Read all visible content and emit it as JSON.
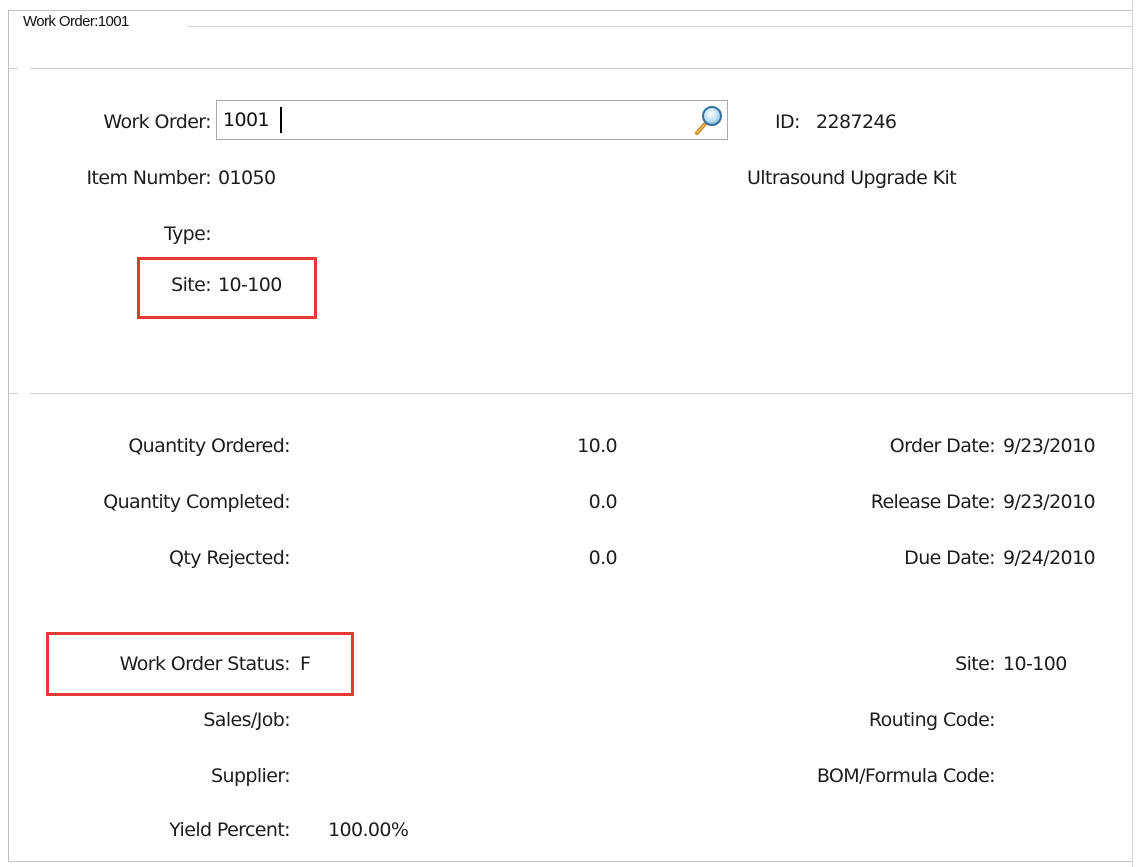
{
  "window": {
    "title": "Work Order:1001"
  },
  "header": {
    "work_order_label": "Work Order:",
    "work_order_value": "1001",
    "id_label": "ID:",
    "id_value": "2287246",
    "item_number_label": "Item Number:",
    "item_number_value": "01050",
    "item_description": "Ultrasound Upgrade Kit",
    "type_label": "Type:",
    "type_value": "",
    "site_label": "Site:",
    "site_value": "10-100"
  },
  "quantities": {
    "ordered_label": "Quantity Ordered:",
    "ordered_value": "10.0",
    "completed_label": "Quantity Completed:",
    "completed_value": "0.0",
    "rejected_label": "Qty Rejected:",
    "rejected_value": "0.0"
  },
  "dates": {
    "order_date_label": "Order Date:",
    "order_date_value": "9/23/2010",
    "release_date_label": "Release Date:",
    "release_date_value": "9/23/2010",
    "due_date_label": "Due Date:",
    "due_date_value": "9/24/2010"
  },
  "status": {
    "status_label": "Work Order Status:",
    "status_value": "F",
    "site_label": "Site:",
    "site_value": "10-100",
    "sales_job_label": "Sales/Job:",
    "sales_job_value": "",
    "routing_code_label": "Routing Code:",
    "routing_code_value": "",
    "supplier_label": "Supplier:",
    "supplier_value": "",
    "bom_formula_label": "BOM/Formula Code:",
    "bom_formula_value": "",
    "yield_label": "Yield Percent:",
    "yield_value": "100.00%"
  },
  "colors": {
    "highlight": "#e53935",
    "frame": "#c8c8c8"
  }
}
